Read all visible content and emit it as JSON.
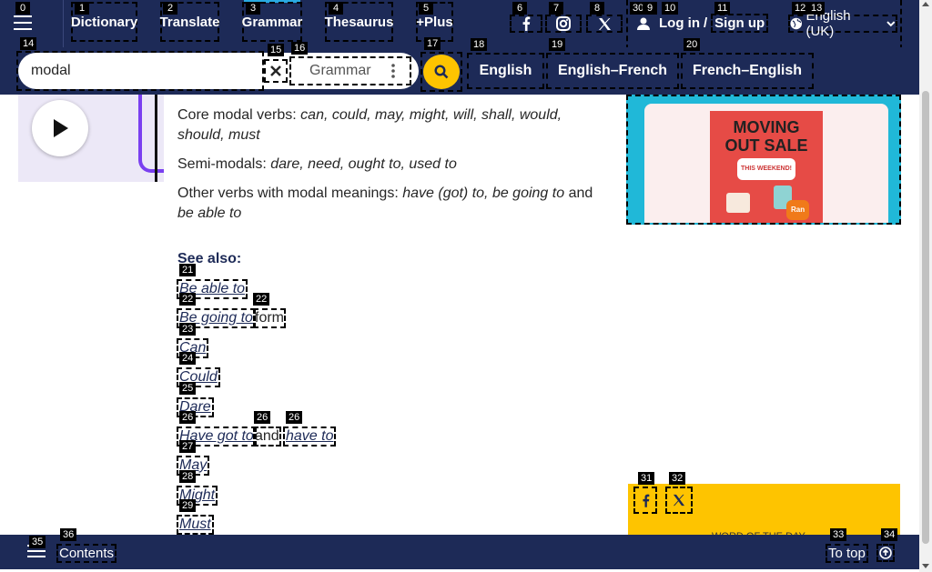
{
  "nav": {
    "dictionary": "Dictionary",
    "translate": "Translate",
    "grammar": "Grammar",
    "thesaurus": "Thesaurus",
    "plus": "+Plus",
    "login": "Log in",
    "slash": "/",
    "signup": "Sign up",
    "language": "English (UK)"
  },
  "search": {
    "value": "modal",
    "dictionary": "Grammar"
  },
  "dict_tabs": [
    "English",
    "English–French",
    "French–English"
  ],
  "content": {
    "core_label": "Core modal verbs: ",
    "core_items": "can, could, may, might, will, shall, would, should, must",
    "semi_label": "Semi-modals: ",
    "semi_items": "dare, need, ought to, used to",
    "other_label": "Other verbs with modal meanings: ",
    "other_items_a": "have (got) to, be going to",
    "other_and": " and ",
    "other_items_b": "be able to",
    "see_also": "See also:"
  },
  "see_also_links": {
    "be_able_to": "Be able to",
    "be_going_to": "Be going to",
    "form": " form",
    "can": "Can",
    "could": "Could",
    "dare": "Dare",
    "have_got_to": "Have got to",
    "and": "and",
    "have_to": "have to",
    "may": "May",
    "might": "Might",
    "must": "Must"
  },
  "ad": {
    "line1": "MOVING",
    "line2": "OUT SALE",
    "tag": "THIS WEEKEND!",
    "cta": "Ran"
  },
  "wotd": {
    "label": "WORD OF THE DAY"
  },
  "bottom": {
    "contents": "Contents",
    "to_top": "To top"
  },
  "badges": {
    "b0": "0",
    "b1": "1",
    "b2": "2",
    "b3": "3",
    "b4": "4",
    "b5": "5",
    "b6": "6",
    "b7": "7",
    "b8": "8",
    "b9": "9",
    "b10": "10",
    "b11": "11",
    "b12": "12",
    "b13": "13",
    "b14": "14",
    "b15": "15",
    "b16": "16",
    "b17": "17",
    "b18": "18",
    "b19": "19",
    "b20": "20",
    "b21": "21",
    "b22": "22",
    "b23": "23",
    "b24": "24",
    "b25": "25",
    "b26": "26",
    "b27": "27",
    "b28": "28",
    "b29": "29",
    "b30": "30",
    "b31": "31",
    "b32": "32",
    "b33": "33",
    "b34": "34",
    "b35": "35",
    "b36": "36"
  },
  "colors": {
    "navy": "#1d2a57",
    "yellow": "#fec400",
    "accent": "#29aae1"
  }
}
